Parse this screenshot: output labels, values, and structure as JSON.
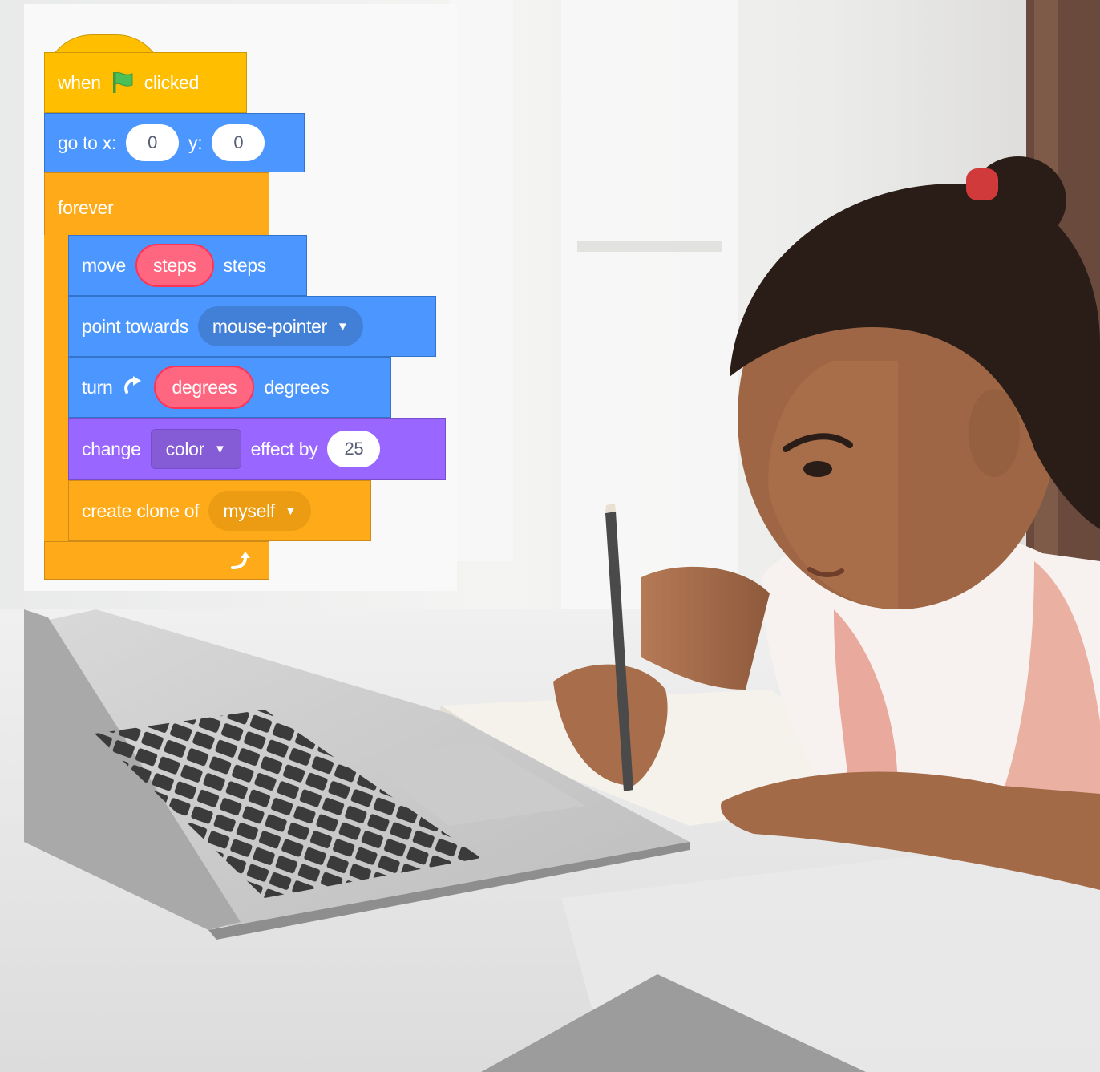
{
  "blocks": {
    "hat": {
      "word1": "when",
      "word2": "clicked",
      "icon": "green-flag-icon"
    },
    "goto": {
      "label": "go to x:",
      "x_value": "0",
      "y_label": "y:",
      "y_value": "0"
    },
    "forever": {
      "label": "forever",
      "end_icon": "loop-arrow-icon"
    },
    "move": {
      "label": "move",
      "reporter": "steps",
      "suffix": "steps"
    },
    "point": {
      "label": "point towards",
      "menu_value": "mouse-pointer"
    },
    "turn": {
      "label": "turn",
      "icon": "rotate-clockwise-icon",
      "reporter": "degrees",
      "suffix": "degrees"
    },
    "change": {
      "label": "change",
      "menu_value": "color",
      "middle": "effect by",
      "value": "25"
    },
    "clone": {
      "label": "create clone of",
      "menu_value": "myself"
    }
  },
  "colors": {
    "events": "#ffbf00",
    "motion": "#4c97ff",
    "control": "#ffab19",
    "looks": "#9966ff",
    "reporter": "#ff6680"
  },
  "photo": {
    "subject": "girl-writing-beside-laptop"
  }
}
